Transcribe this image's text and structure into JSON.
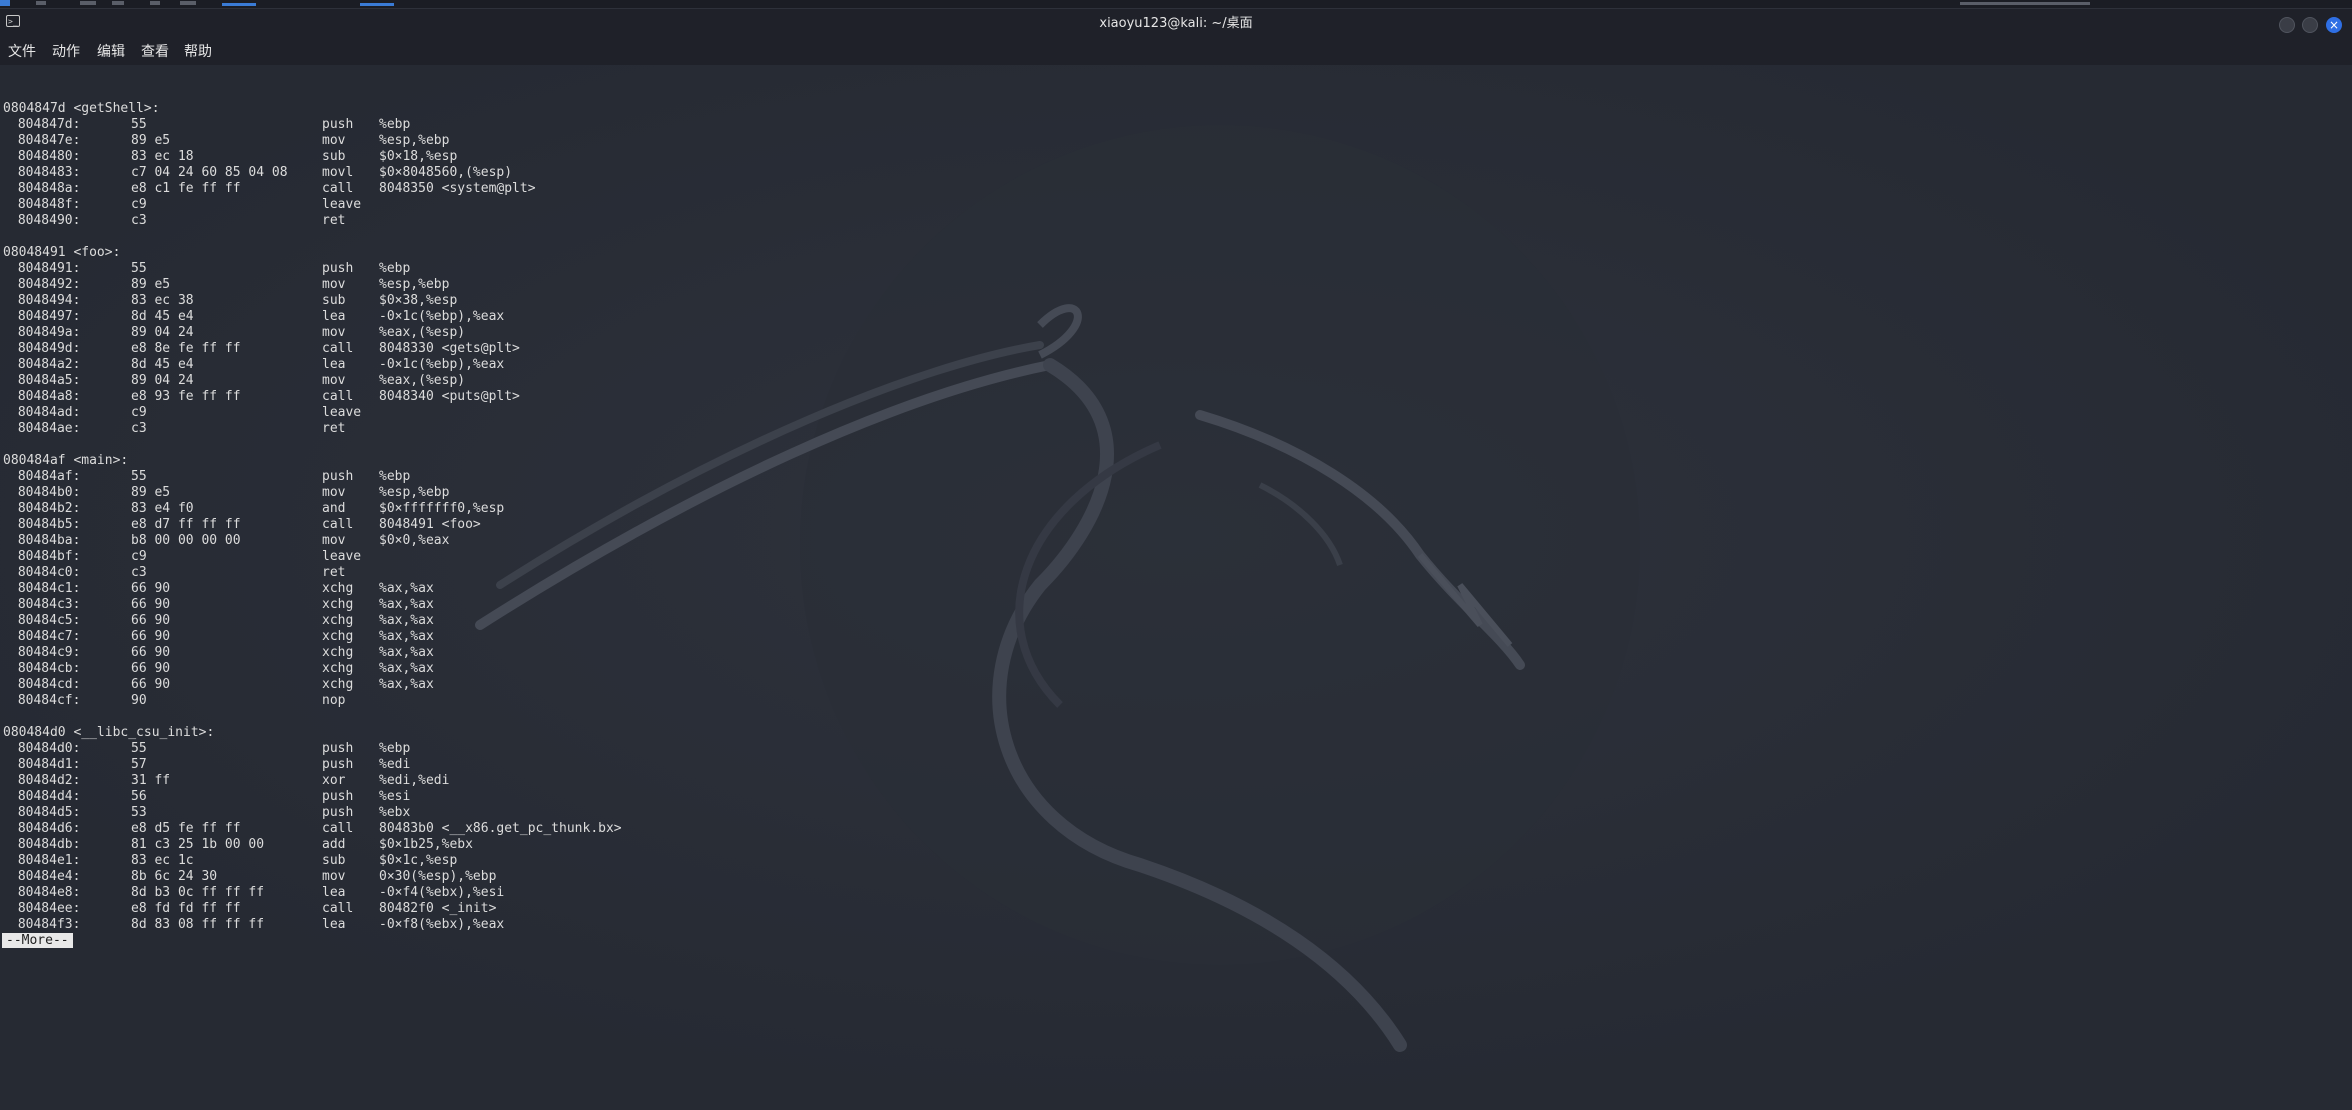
{
  "window": {
    "title": "xiaoyu123@kali: ~/桌面"
  },
  "menu": [
    "文件",
    "动作",
    "编辑",
    "查看",
    "帮助"
  ],
  "disassembly": [
    {
      "type": "blank"
    },
    {
      "type": "header",
      "text": "0804847d <getShell>:"
    },
    {
      "type": "ins",
      "addr": " 804847d:",
      "bytes": "55",
      "mnemonic": "push",
      "operands": "%ebp"
    },
    {
      "type": "ins",
      "addr": " 804847e:",
      "bytes": "89 e5",
      "mnemonic": "mov",
      "operands": "%esp,%ebp"
    },
    {
      "type": "ins",
      "addr": " 8048480:",
      "bytes": "83 ec 18",
      "mnemonic": "sub",
      "operands": "$0×18,%esp"
    },
    {
      "type": "ins",
      "addr": " 8048483:",
      "bytes": "c7 04 24 60 85 04 08",
      "mnemonic": "movl",
      "operands": "$0×8048560,(%esp)"
    },
    {
      "type": "ins",
      "addr": " 804848a:",
      "bytes": "e8 c1 fe ff ff",
      "mnemonic": "call",
      "operands": "8048350 <system@plt>"
    },
    {
      "type": "ins",
      "addr": " 804848f:",
      "bytes": "c9",
      "mnemonic": "leave",
      "operands": ""
    },
    {
      "type": "ins",
      "addr": " 8048490:",
      "bytes": "c3",
      "mnemonic": "ret",
      "operands": ""
    },
    {
      "type": "blank"
    },
    {
      "type": "header",
      "text": "08048491 <foo>:"
    },
    {
      "type": "ins",
      "addr": " 8048491:",
      "bytes": "55",
      "mnemonic": "push",
      "operands": "%ebp"
    },
    {
      "type": "ins",
      "addr": " 8048492:",
      "bytes": "89 e5",
      "mnemonic": "mov",
      "operands": "%esp,%ebp"
    },
    {
      "type": "ins",
      "addr": " 8048494:",
      "bytes": "83 ec 38",
      "mnemonic": "sub",
      "operands": "$0×38,%esp"
    },
    {
      "type": "ins",
      "addr": " 8048497:",
      "bytes": "8d 45 e4",
      "mnemonic": "lea",
      "operands": "-0×1c(%ebp),%eax"
    },
    {
      "type": "ins",
      "addr": " 804849a:",
      "bytes": "89 04 24",
      "mnemonic": "mov",
      "operands": "%eax,(%esp)"
    },
    {
      "type": "ins",
      "addr": " 804849d:",
      "bytes": "e8 8e fe ff ff",
      "mnemonic": "call",
      "operands": "8048330 <gets@plt>"
    },
    {
      "type": "ins",
      "addr": " 80484a2:",
      "bytes": "8d 45 e4",
      "mnemonic": "lea",
      "operands": "-0×1c(%ebp),%eax"
    },
    {
      "type": "ins",
      "addr": " 80484a5:",
      "bytes": "89 04 24",
      "mnemonic": "mov",
      "operands": "%eax,(%esp)"
    },
    {
      "type": "ins",
      "addr": " 80484a8:",
      "bytes": "e8 93 fe ff ff",
      "mnemonic": "call",
      "operands": "8048340 <puts@plt>"
    },
    {
      "type": "ins",
      "addr": " 80484ad:",
      "bytes": "c9",
      "mnemonic": "leave",
      "operands": ""
    },
    {
      "type": "ins",
      "addr": " 80484ae:",
      "bytes": "c3",
      "mnemonic": "ret",
      "operands": ""
    },
    {
      "type": "blank"
    },
    {
      "type": "header",
      "text": "080484af <main>:"
    },
    {
      "type": "ins",
      "addr": " 80484af:",
      "bytes": "55",
      "mnemonic": "push",
      "operands": "%ebp"
    },
    {
      "type": "ins",
      "addr": " 80484b0:",
      "bytes": "89 e5",
      "mnemonic": "mov",
      "operands": "%esp,%ebp"
    },
    {
      "type": "ins",
      "addr": " 80484b2:",
      "bytes": "83 e4 f0",
      "mnemonic": "and",
      "operands": "$0×fffffff0,%esp"
    },
    {
      "type": "ins",
      "addr": " 80484b5:",
      "bytes": "e8 d7 ff ff ff",
      "mnemonic": "call",
      "operands": "8048491 <foo>"
    },
    {
      "type": "ins",
      "addr": " 80484ba:",
      "bytes": "b8 00 00 00 00",
      "mnemonic": "mov",
      "operands": "$0×0,%eax"
    },
    {
      "type": "ins",
      "addr": " 80484bf:",
      "bytes": "c9",
      "mnemonic": "leave",
      "operands": ""
    },
    {
      "type": "ins",
      "addr": " 80484c0:",
      "bytes": "c3",
      "mnemonic": "ret",
      "operands": ""
    },
    {
      "type": "ins",
      "addr": " 80484c1:",
      "bytes": "66 90",
      "mnemonic": "xchg",
      "operands": "%ax,%ax"
    },
    {
      "type": "ins",
      "addr": " 80484c3:",
      "bytes": "66 90",
      "mnemonic": "xchg",
      "operands": "%ax,%ax"
    },
    {
      "type": "ins",
      "addr": " 80484c5:",
      "bytes": "66 90",
      "mnemonic": "xchg",
      "operands": "%ax,%ax"
    },
    {
      "type": "ins",
      "addr": " 80484c7:",
      "bytes": "66 90",
      "mnemonic": "xchg",
      "operands": "%ax,%ax"
    },
    {
      "type": "ins",
      "addr": " 80484c9:",
      "bytes": "66 90",
      "mnemonic": "xchg",
      "operands": "%ax,%ax"
    },
    {
      "type": "ins",
      "addr": " 80484cb:",
      "bytes": "66 90",
      "mnemonic": "xchg",
      "operands": "%ax,%ax"
    },
    {
      "type": "ins",
      "addr": " 80484cd:",
      "bytes": "66 90",
      "mnemonic": "xchg",
      "operands": "%ax,%ax"
    },
    {
      "type": "ins",
      "addr": " 80484cf:",
      "bytes": "90",
      "mnemonic": "nop",
      "operands": ""
    },
    {
      "type": "blank"
    },
    {
      "type": "header",
      "text": "080484d0 <__libc_csu_init>:"
    },
    {
      "type": "ins",
      "addr": " 80484d0:",
      "bytes": "55",
      "mnemonic": "push",
      "operands": "%ebp"
    },
    {
      "type": "ins",
      "addr": " 80484d1:",
      "bytes": "57",
      "mnemonic": "push",
      "operands": "%edi"
    },
    {
      "type": "ins",
      "addr": " 80484d2:",
      "bytes": "31 ff",
      "mnemonic": "xor",
      "operands": "%edi,%edi"
    },
    {
      "type": "ins",
      "addr": " 80484d4:",
      "bytes": "56",
      "mnemonic": "push",
      "operands": "%esi"
    },
    {
      "type": "ins",
      "addr": " 80484d5:",
      "bytes": "53",
      "mnemonic": "push",
      "operands": "%ebx"
    },
    {
      "type": "ins",
      "addr": " 80484d6:",
      "bytes": "e8 d5 fe ff ff",
      "mnemonic": "call",
      "operands": "80483b0 <__x86.get_pc_thunk.bx>"
    },
    {
      "type": "ins",
      "addr": " 80484db:",
      "bytes": "81 c3 25 1b 00 00",
      "mnemonic": "add",
      "operands": "$0×1b25,%ebx"
    },
    {
      "type": "ins",
      "addr": " 80484e1:",
      "bytes": "83 ec 1c",
      "mnemonic": "sub",
      "operands": "$0×1c,%esp"
    },
    {
      "type": "ins",
      "addr": " 80484e4:",
      "bytes": "8b 6c 24 30",
      "mnemonic": "mov",
      "operands": "0×30(%esp),%ebp"
    },
    {
      "type": "ins",
      "addr": " 80484e8:",
      "bytes": "8d b3 0c ff ff ff",
      "mnemonic": "lea",
      "operands": "-0×f4(%ebx),%esi"
    },
    {
      "type": "ins",
      "addr": " 80484ee:",
      "bytes": "e8 fd fd ff ff",
      "mnemonic": "call",
      "operands": "80482f0 <_init>"
    },
    {
      "type": "ins",
      "addr": " 80484f3:",
      "bytes": "8d 83 08 ff ff ff",
      "mnemonic": "lea",
      "operands": "-0×f8(%ebx),%eax"
    },
    {
      "type": "more",
      "text": "--More--"
    }
  ],
  "colors": {
    "terminal_bg": "#262a33",
    "text": "#dcdcdc",
    "close_button": "#2f6fe4"
  }
}
